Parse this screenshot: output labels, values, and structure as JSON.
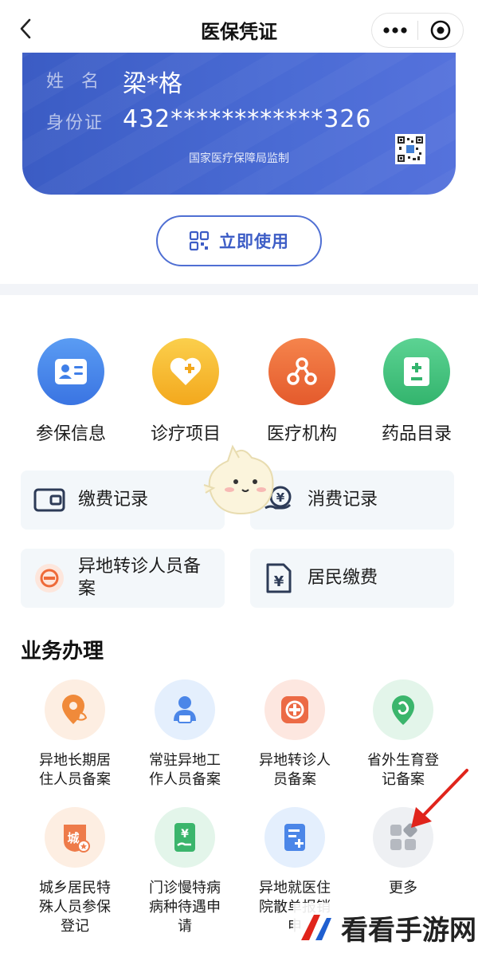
{
  "header": {
    "title": "医保凭证",
    "back_icon": "chevron-left-icon",
    "more_icon": "more-dots-icon",
    "close_icon": "target-icon"
  },
  "card": {
    "name_label": "姓名",
    "name_value": "梁*格",
    "id_label": "身份证",
    "id_value": "432************326",
    "footnote": "国家医疗保障局监制",
    "qr_icon": "qr-code-icon",
    "color": "#4466cc"
  },
  "use_button": {
    "label": "立即使用",
    "icon": "qr-scan-icon"
  },
  "main_items": [
    {
      "label": "参保信息",
      "icon": "id-card-icon",
      "color": "#3f7fe8"
    },
    {
      "label": "诊疗项目",
      "icon": "heart-plus-icon",
      "color": "#f5b72a"
    },
    {
      "label": "医疗机构",
      "icon": "network-icon",
      "color": "#ee6a38"
    },
    {
      "label": "药品目录",
      "icon": "plus-minus-icon",
      "color": "#3fbf7a"
    }
  ],
  "tiles": [
    {
      "label": "缴费记录",
      "icon": "wallet-icon"
    },
    {
      "label": "消费记录",
      "icon": "yuan-hand-icon"
    },
    {
      "label_line1": "异地转诊人员备",
      "label_line2": "案",
      "icon": "transfer-icon"
    },
    {
      "label": "居民缴费",
      "icon": "yuan-doc-icon"
    }
  ],
  "section_title": "业务办理",
  "services": [
    {
      "line1": "异地长期居",
      "line2": "住人员备案",
      "line3": "",
      "icon": "location-phone-icon"
    },
    {
      "line1": "常驻异地工",
      "line2": "作人员备案",
      "line3": "",
      "icon": "worker-icon"
    },
    {
      "line1": "异地转诊人",
      "line2": "员备案",
      "line3": "",
      "icon": "medical-cross-icon"
    },
    {
      "line1": "省外生育登",
      "line2": "记备案",
      "line3": "",
      "icon": "baby-pin-icon"
    },
    {
      "line1": "城乡居民特",
      "line2": "殊人员参保",
      "line3": "登记",
      "icon": "city-badge-icon"
    },
    {
      "line1": "门诊慢特病",
      "line2": "病种待遇申",
      "line3": "请",
      "icon": "yuan-hand-doc-icon"
    },
    {
      "line1": "异地就医住",
      "line2": "院散单报销",
      "line3": "申",
      "icon": "doc-plus-icon"
    },
    {
      "line1": "更多",
      "line2": "",
      "line3": "",
      "icon": "grid-more-icon"
    }
  ],
  "watermark": {
    "text": "看看手游网"
  }
}
